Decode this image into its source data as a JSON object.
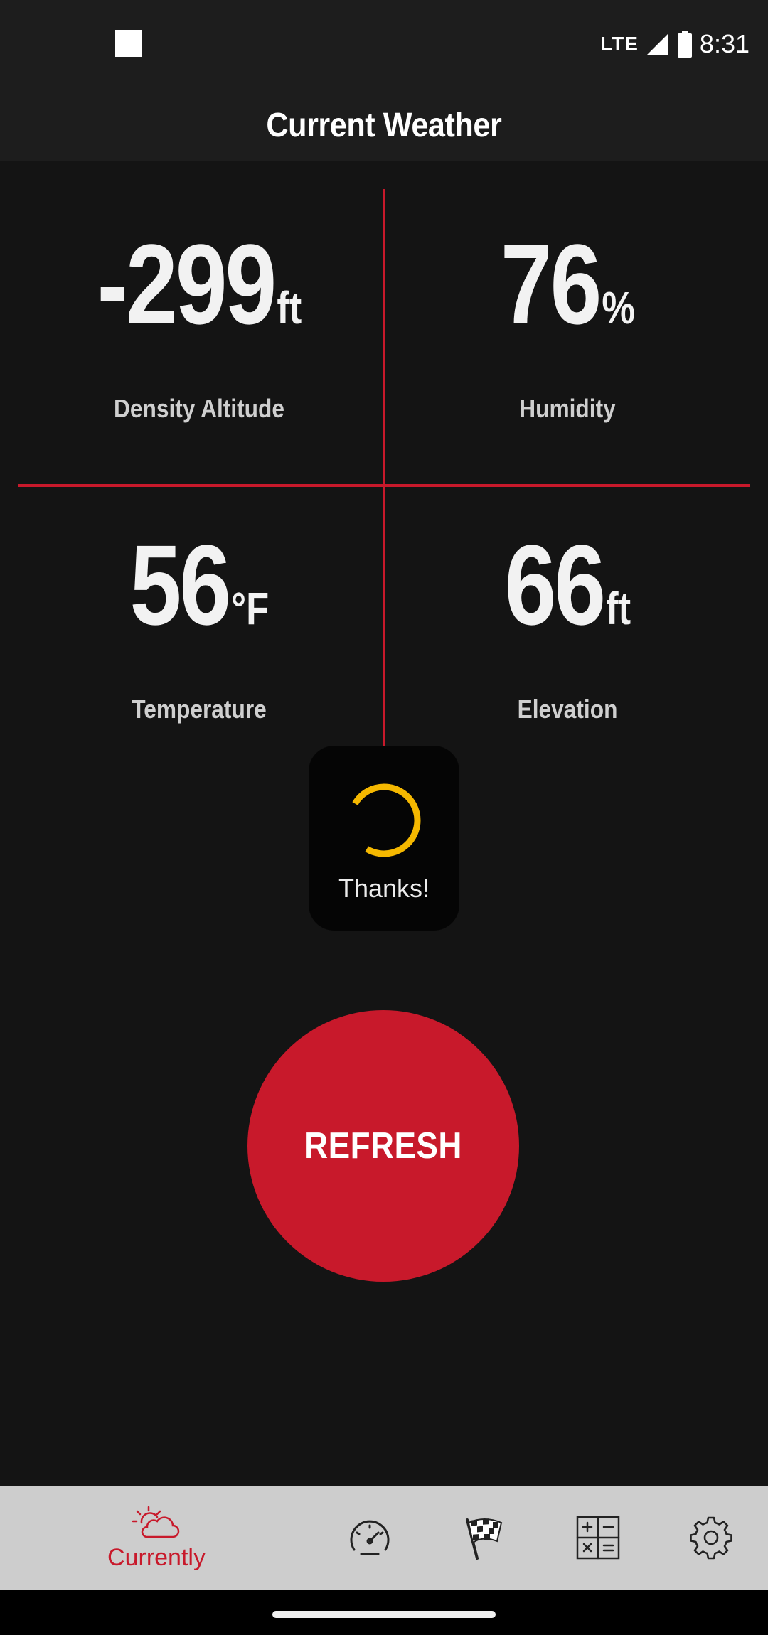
{
  "status_bar": {
    "network": "LTE",
    "time": "8:31"
  },
  "app_bar": {
    "title": "Current Weather"
  },
  "metrics": [
    {
      "value": "-299",
      "unit": "ft",
      "label": "Density Altitude"
    },
    {
      "value": "76",
      "unit": "%",
      "label": "Humidity"
    },
    {
      "value": "56",
      "unit": "°F",
      "label": "Temperature"
    },
    {
      "value": "66",
      "unit": "ft",
      "label": "Elevation"
    }
  ],
  "toast": {
    "text": "Thanks!",
    "spinner_color": "#f5b800"
  },
  "refresh_button": {
    "label": "REFRESH"
  },
  "bottom_nav": {
    "active_label": "Currently",
    "items": [
      "weather-icon",
      "speedometer-icon",
      "checkered-flag-icon",
      "calculator-icon",
      "gear-icon"
    ]
  },
  "colors": {
    "accent": "#c8192b",
    "background": "#141414",
    "nav_background": "#cdcdcd"
  }
}
